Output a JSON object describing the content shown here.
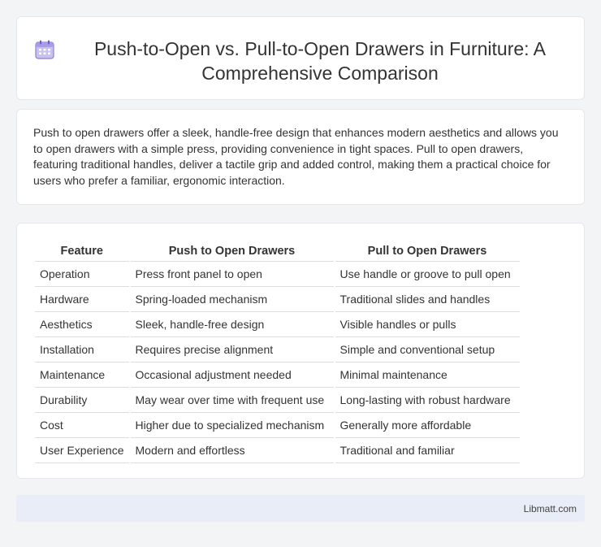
{
  "header": {
    "icon": "calendar-grid-icon",
    "title": "Push-to-Open vs. Pull-to-Open Drawers in Furniture: A Comprehensive Comparison"
  },
  "intro": {
    "text": "Push to open drawers offer a sleek, handle-free design that enhances modern aesthetics and allows you to open drawers with a simple press, providing convenience in tight spaces. Pull to open drawers, featuring traditional handles, deliver a tactile grip and added control, making them a practical choice for users who prefer a familiar, ergonomic interaction."
  },
  "table": {
    "headers": [
      "Feature",
      "Push to Open Drawers",
      "Pull to Open Drawers"
    ],
    "rows": [
      [
        "Operation",
        "Press front panel to open",
        "Use handle or groove to pull open"
      ],
      [
        "Hardware",
        "Spring-loaded mechanism",
        "Traditional slides and handles"
      ],
      [
        "Aesthetics",
        "Sleek, handle-free design",
        "Visible handles or pulls"
      ],
      [
        "Installation",
        "Requires precise alignment",
        "Simple and conventional setup"
      ],
      [
        "Maintenance",
        "Occasional adjustment needed",
        "Minimal maintenance"
      ],
      [
        "Durability",
        "May wear over time with frequent use",
        "Long-lasting with robust hardware"
      ],
      [
        "Cost",
        "Higher due to specialized mechanism",
        "Generally more affordable"
      ],
      [
        "User Experience",
        "Modern and effortless",
        "Traditional and familiar"
      ]
    ]
  },
  "footer": {
    "site": "Libmatt.com"
  },
  "colors": {
    "background": "#f3f4f6",
    "card": "#ffffff",
    "footer": "#e8edf7",
    "icon_accent": "#8b7fd6"
  }
}
